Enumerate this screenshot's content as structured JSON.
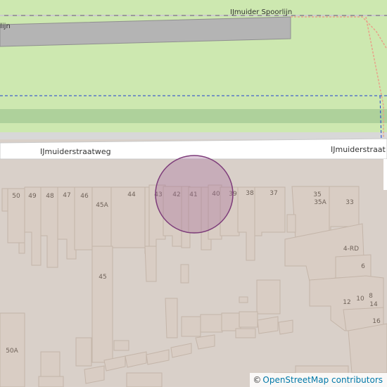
{
  "map": {
    "rail_name": "IJmuider Spoorlijn",
    "rail_name_fragment": "rlijn",
    "road_name": "IJmuiderstraatweg",
    "road_name_right": "IJmuiderstraat",
    "house_numbers": [
      "50",
      "49",
      "48",
      "47",
      "46",
      "45A",
      "44",
      "43",
      "42",
      "41",
      "40",
      "39",
      "38",
      "37",
      "35",
      "35A",
      "33",
      "45",
      "4-RD",
      "6",
      "12",
      "10",
      "8",
      "14",
      "16",
      "50A"
    ],
    "colors": {
      "grass": "#cde8b0",
      "rail_platform": "#b4b4b4",
      "road": "#ffffff",
      "built_area": "#d9d0c9",
      "building": "#d9cdc4",
      "marker_fill": "#a66c9a",
      "marker_stroke": "#7d3c7a",
      "boundary": "#1f3fd1",
      "footway": "#e8a28a"
    }
  },
  "attribution": {
    "symbol": "©",
    "text": "OpenStreetMap contributors"
  }
}
